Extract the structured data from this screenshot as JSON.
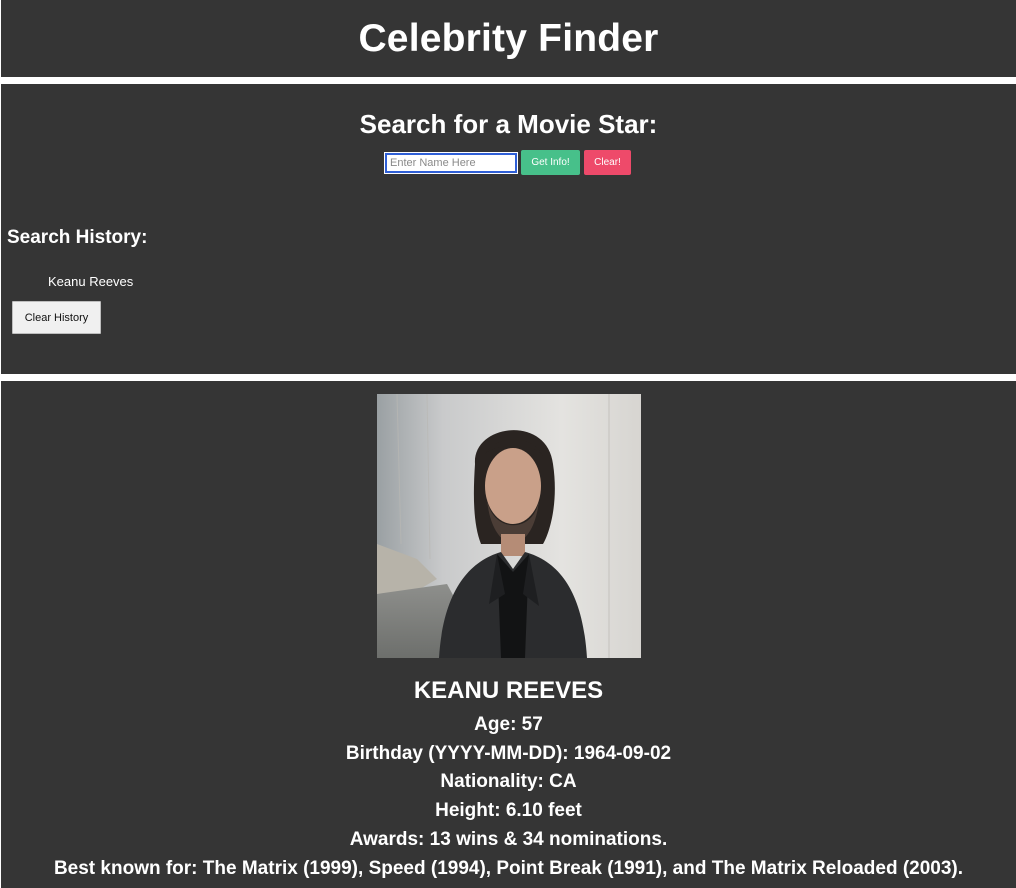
{
  "header": {
    "title": "Celebrity Finder"
  },
  "search": {
    "heading": "Search for a Movie Star:",
    "placeholder": "Enter Name Here",
    "value": "",
    "get_info_label": "Get Info!",
    "clear_label": "Clear!"
  },
  "history": {
    "heading": "Search History:",
    "items": [
      "Keanu Reeves"
    ],
    "clear_label": "Clear History"
  },
  "result": {
    "name": "KEANU REEVES",
    "age": "Age: 57",
    "birthday": "Birthday (YYYY-MM-DD): 1964-09-02",
    "nationality": "Nationality: CA",
    "height": "Height: 6.10 feet",
    "awards": "Awards: 13 wins & 34 nominations.",
    "known_for": "Best known for: The Matrix (1999), Speed (1994), Point Break (1991), and The Matrix Reloaded (2003)."
  },
  "colors": {
    "panel_bg": "#353535",
    "separator": "#ffffff",
    "get_info_button": "#47c08a",
    "clear_button": "#ee4a6a"
  }
}
